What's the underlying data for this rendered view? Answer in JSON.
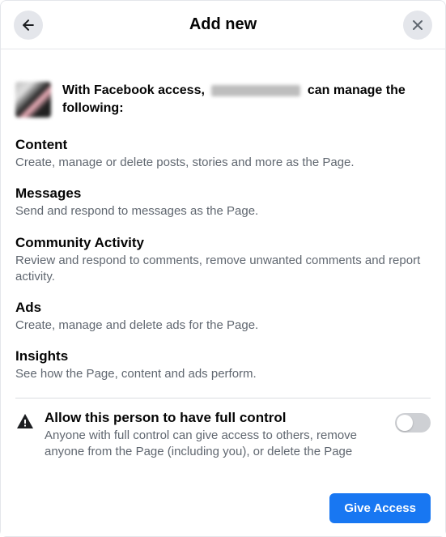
{
  "header": {
    "title": "Add new"
  },
  "intro": {
    "prefix": "With Facebook access, ",
    "suffix": " can manage the following:"
  },
  "sections": [
    {
      "title": "Content",
      "desc": "Create, manage or delete posts, stories and more as the Page."
    },
    {
      "title": "Messages",
      "desc": "Send and respond to messages as the Page."
    },
    {
      "title": "Community Activity",
      "desc": "Review and respond to comments, remove unwanted comments and report activity."
    },
    {
      "title": "Ads",
      "desc": "Create, manage and delete ads for the Page."
    },
    {
      "title": "Insights",
      "desc": "See how the Page, content and ads perform."
    }
  ],
  "fullControl": {
    "title": "Allow this person to have full control",
    "desc": "Anyone with full control can give access to others, remove anyone from the Page (including you), or delete the Page",
    "enabled": false
  },
  "footer": {
    "primary": "Give Access"
  }
}
